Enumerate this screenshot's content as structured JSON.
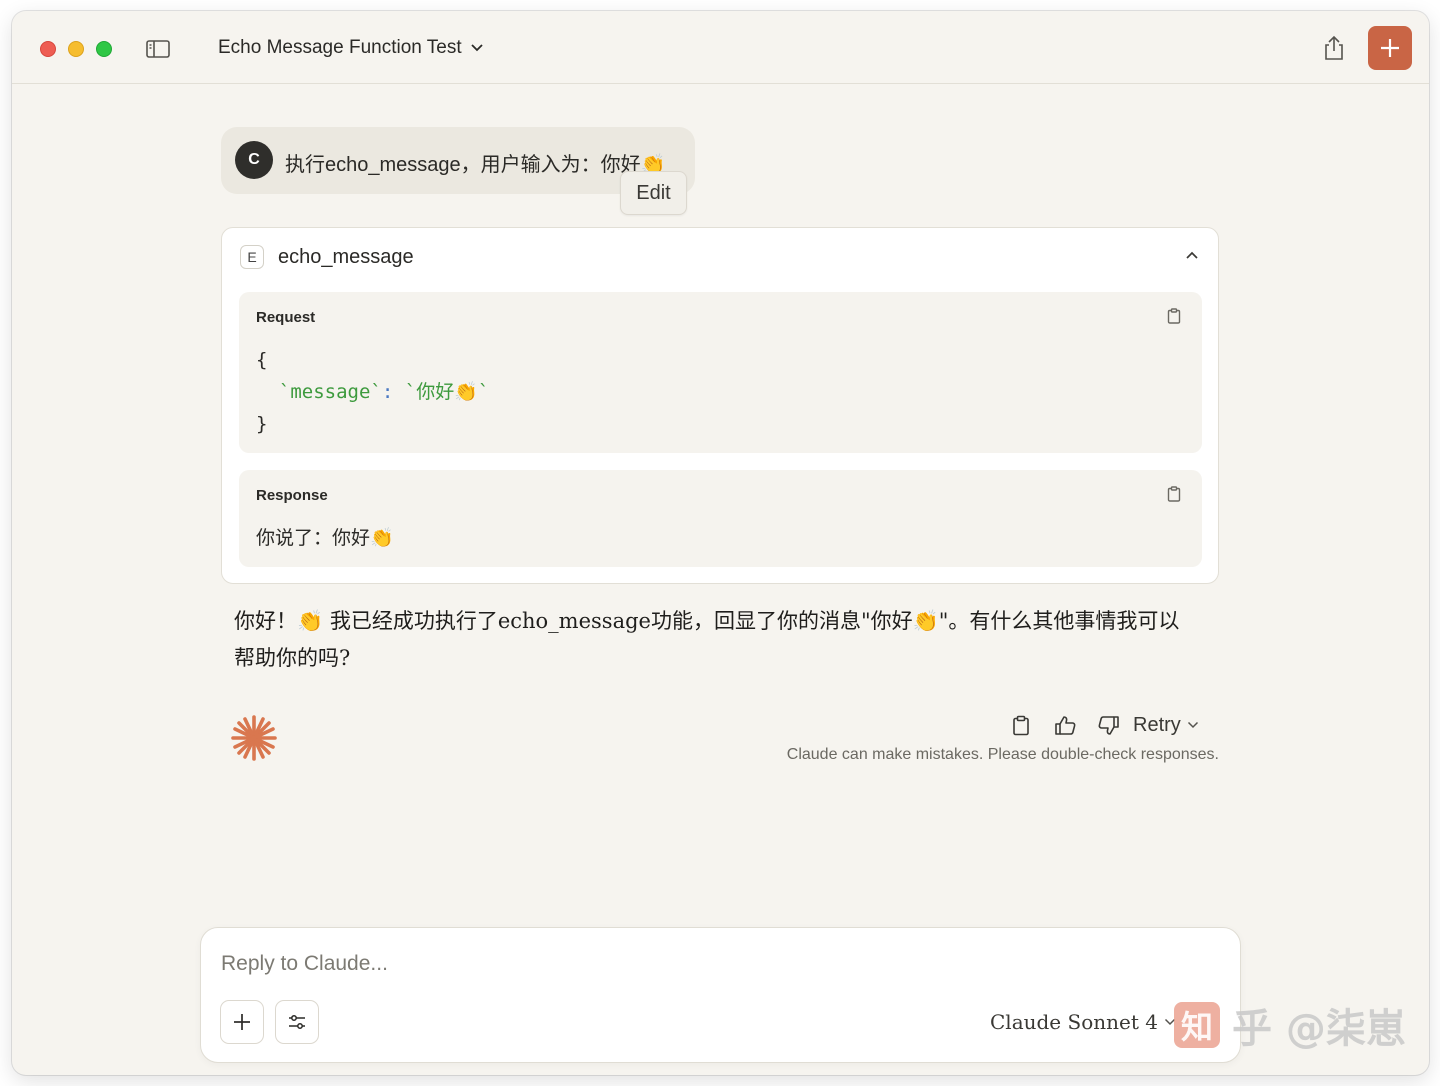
{
  "window": {
    "title": "Echo Message Function Test",
    "accent_color": "#c96545"
  },
  "user_message": {
    "avatar_initial": "C",
    "text": "执行echo_message，用户输入为：你好👏",
    "edit_label": "Edit"
  },
  "tool_call": {
    "badge": "E",
    "name": "echo_message",
    "request": {
      "label": "Request",
      "open_brace": "{",
      "key": "`message`",
      "colon": ":",
      "value": "`你好👏`",
      "close_brace": "}"
    },
    "response": {
      "label": "Response",
      "text": "你说了：你好👏"
    }
  },
  "assistant_message": {
    "text": "你好！👏 我已经成功执行了echo_message功能，回显了你的消息\"你好👏\"。有什么其他事情我可以帮助你的吗?"
  },
  "message_actions": {
    "retry_label": "Retry",
    "disclaimer": "Claude can make mistakes. Please double-check responses."
  },
  "composer": {
    "placeholder": "Reply to Claude...",
    "model": "Claude Sonnet 4"
  },
  "watermark": {
    "logo_text": "知",
    "text": "乎 @柒崽"
  }
}
